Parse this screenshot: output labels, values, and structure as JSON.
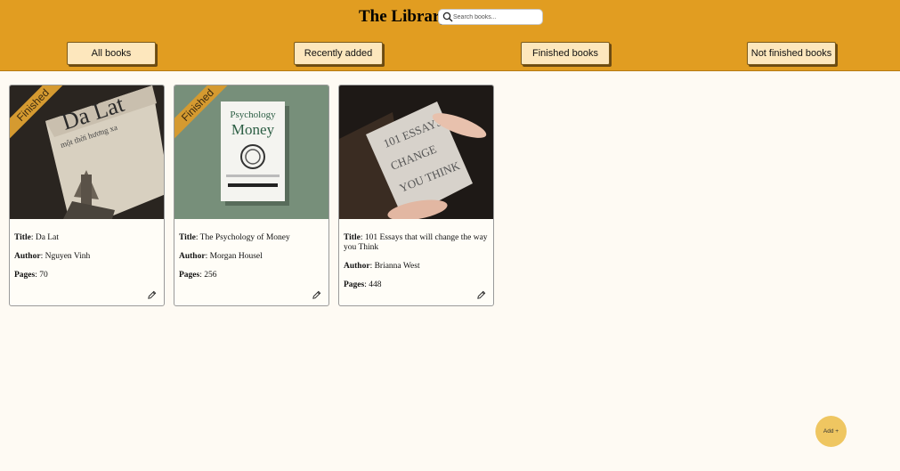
{
  "header": {
    "title": "The Library"
  },
  "search": {
    "placeholder": "Search books...",
    "icon": "search-icon"
  },
  "nav": [
    {
      "label": "All books"
    },
    {
      "label": "Recently added"
    },
    {
      "label": "Finished books"
    },
    {
      "label": "Not finished books"
    }
  ],
  "labels": {
    "title": "Title",
    "author": "Author",
    "pages": "Pages",
    "finished_ribbon": "Finished"
  },
  "books": [
    {
      "title": "Da Lat",
      "author": "Nguyen Vinh",
      "pages": "70",
      "finished": true
    },
    {
      "title": "The Psychology of Money",
      "author": "Morgan Housel",
      "pages": "256",
      "finished": true
    },
    {
      "title": "101 Essays that will change the way you Think",
      "author": "Brianna West",
      "pages": "448",
      "finished": false
    }
  ],
  "add_button": {
    "label": "Add +"
  },
  "colors": {
    "header": "#e19d21",
    "nav_button": "#fde7bd",
    "ribbon": "#d59a30",
    "add_button": "#efc661",
    "background": "#fefaf3"
  }
}
